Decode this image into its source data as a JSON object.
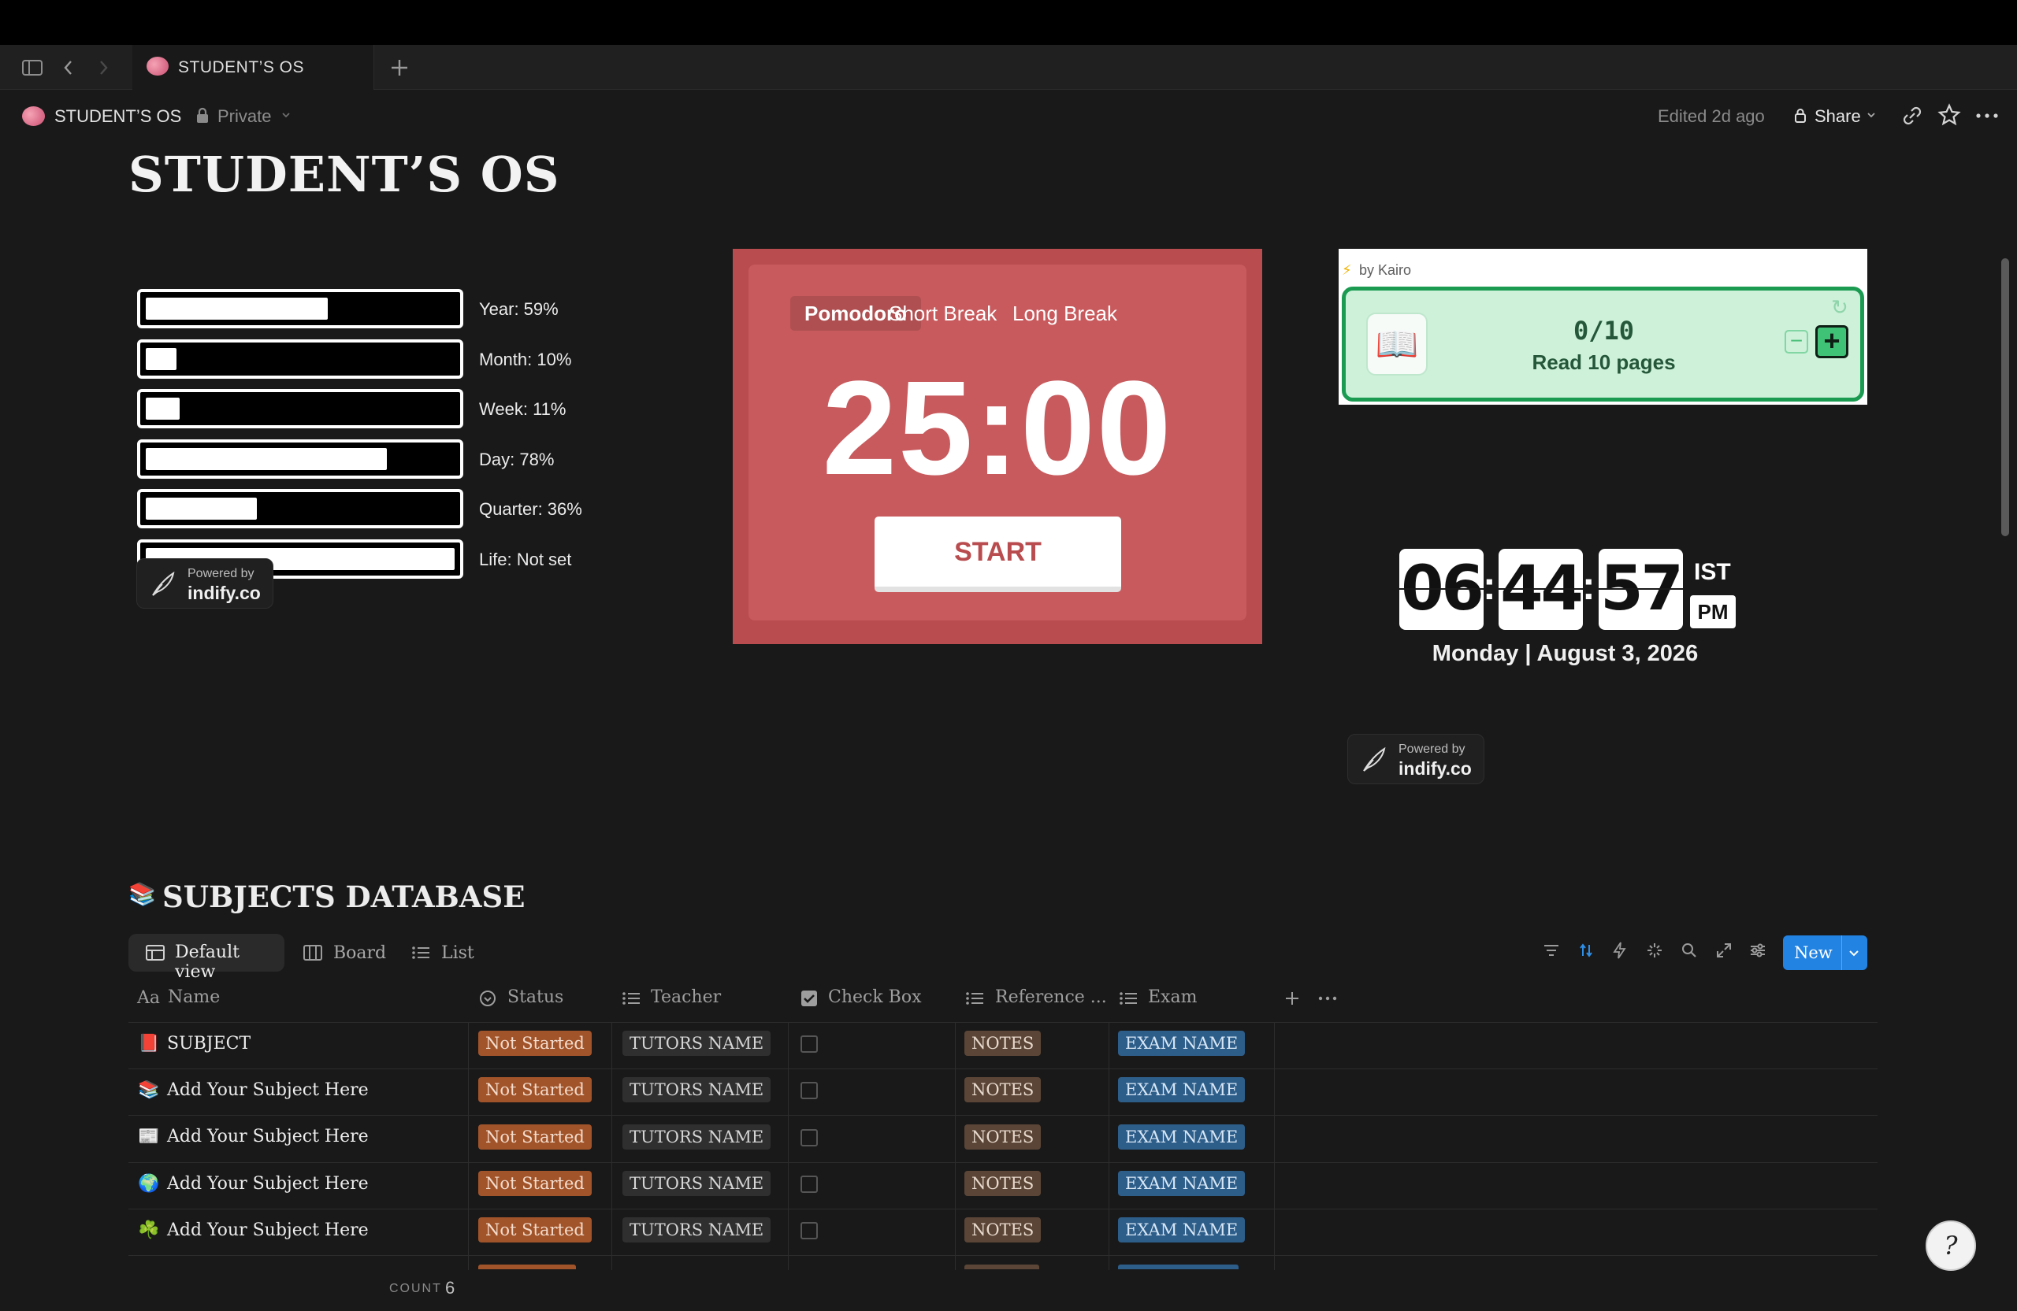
{
  "window": {
    "tab_title": "STUDENT’S OS",
    "new_tab_icon": "plus-icon"
  },
  "breadcrumb": {
    "page": "STUDENT’S OS",
    "privacy": "Private",
    "edited": "Edited 2d ago",
    "share": "Share"
  },
  "page": {
    "title": "STUDENT’S OS"
  },
  "progress": {
    "items": [
      {
        "label": "Year: 59%",
        "fraction": 0.59
      },
      {
        "label": "Month: 10%",
        "fraction": 0.1
      },
      {
        "label": "Week: 11%",
        "fraction": 0.11
      },
      {
        "label": "Day: 78%",
        "fraction": 0.78
      },
      {
        "label": "Quarter: 36%",
        "fraction": 0.36
      },
      {
        "label": "Life: Not set",
        "fraction": 1.0
      }
    ],
    "powered_by": "Powered by",
    "powered_brand": "indify.co"
  },
  "pomodoro": {
    "tabs": [
      "Pomodoro",
      "Short Break",
      "Long Break"
    ],
    "active_tab": "Pomodoro",
    "time": "25:00",
    "start_label": "START",
    "bg_color": "#b84c4f"
  },
  "habit": {
    "by": "by Kairo",
    "count": "0/10",
    "label": "Read 10 pages",
    "accent_color": "#1a9b51"
  },
  "clock": {
    "hours": "06",
    "minutes": "44",
    "seconds": "57",
    "timezone": "IST",
    "ampm": "PM",
    "date": "Monday | August 3, 2026",
    "powered_by": "Powered by",
    "powered_brand": "indify.co"
  },
  "database": {
    "title": "SUBJECTS DATABASE",
    "views": [
      "Default view",
      "Board",
      "List"
    ],
    "new_label": "New",
    "columns": [
      "Name",
      "Status",
      "Teacher",
      "Check Box",
      "Reference ...",
      "Exam"
    ],
    "rows": [
      {
        "icon": "📕",
        "name": "SUBJECT",
        "status": "Not Started",
        "teacher": "TUTORS NAME",
        "checked": false,
        "reference": "NOTES",
        "exam": "EXAM NAME"
      },
      {
        "icon": "📚",
        "name": "Add Your Subject Here",
        "status": "Not Started",
        "teacher": "TUTORS NAME",
        "checked": false,
        "reference": "NOTES",
        "exam": "EXAM NAME"
      },
      {
        "icon": "📰",
        "name": "Add Your Subject Here",
        "status": "Not Started",
        "teacher": "TUTORS NAME",
        "checked": false,
        "reference": "NOTES",
        "exam": "EXAM NAME"
      },
      {
        "icon": "🌍",
        "name": "Add Your Subject Here",
        "status": "Not Started",
        "teacher": "TUTORS NAME",
        "checked": false,
        "reference": "NOTES",
        "exam": "EXAM NAME"
      },
      {
        "icon": "☘️",
        "name": "Add Your Subject Here",
        "status": "Not Started",
        "teacher": "TUTORS NAME",
        "checked": false,
        "reference": "NOTES",
        "exam": "EXAM NAME"
      }
    ],
    "count_label": "COUNT",
    "count_value": "6"
  }
}
